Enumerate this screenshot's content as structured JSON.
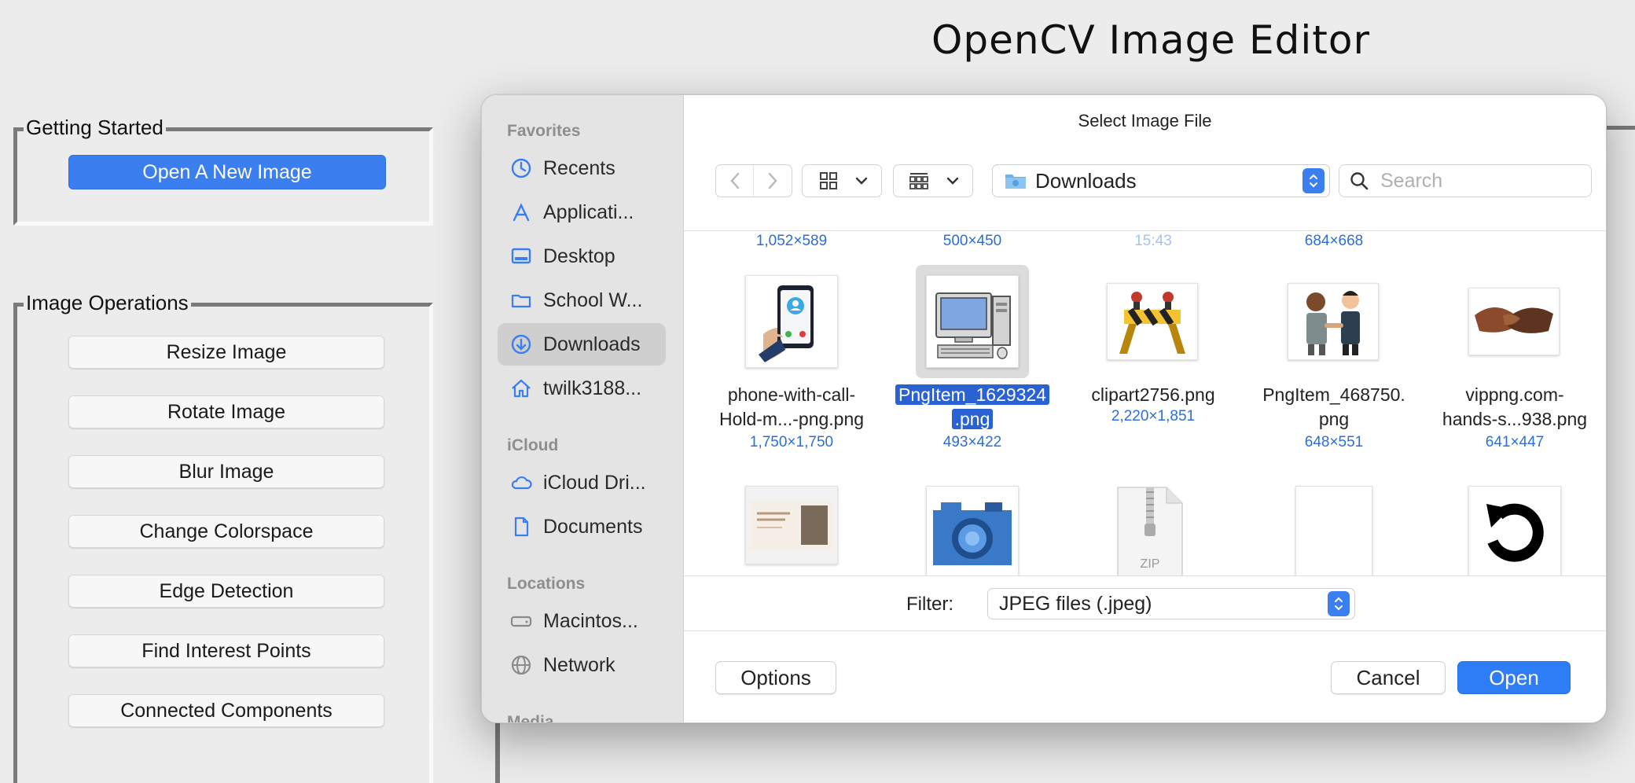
{
  "app": {
    "title": "OpenCV Image Editor"
  },
  "getting_started": {
    "legend": "Getting Started",
    "open_button": "Open A New Image"
  },
  "image_operations": {
    "legend": "Image Operations",
    "buttons": [
      "Resize Image",
      "Rotate Image",
      "Blur Image",
      "Change Colorspace",
      "Edge Detection",
      "Find Interest Points",
      "Connected Components"
    ]
  },
  "dialog": {
    "title": "Select Image File",
    "sidebar": {
      "favorites_header": "Favorites",
      "favorites": [
        {
          "label": "Recents",
          "icon": "clock-icon"
        },
        {
          "label": "Applicati...",
          "icon": "applications-icon"
        },
        {
          "label": "Desktop",
          "icon": "desktop-icon"
        },
        {
          "label": "School W...",
          "icon": "folder-icon"
        },
        {
          "label": "Downloads",
          "icon": "download-icon"
        },
        {
          "label": "twilk3188...",
          "icon": "home-icon"
        }
      ],
      "icloud_header": "iCloud",
      "icloud": [
        {
          "label": "iCloud Dri...",
          "icon": "cloud-icon"
        },
        {
          "label": "Documents",
          "icon": "document-icon"
        }
      ],
      "locations_header": "Locations",
      "locations": [
        {
          "label": "Macintos...",
          "icon": "drive-icon"
        },
        {
          "label": "Network",
          "icon": "globe-icon"
        }
      ],
      "media_header": "Media"
    },
    "location": "Downloads",
    "search_placeholder": "Search",
    "top_row_dims": [
      "1,052×589",
      "500×450",
      "15:43",
      "684×668"
    ],
    "files": [
      {
        "name_line1": "phone-with-call-",
        "name_line2": "Hold-m...-png.png",
        "dims": "1,750×1,750"
      },
      {
        "name_line1": "PngItem_1629324",
        "name_line2": ".png",
        "dims": "493×422",
        "selected": true
      },
      {
        "name_line1": "clipart2756.png",
        "name_line2": "",
        "dims": "2,220×1,851"
      },
      {
        "name_line1": "PngItem_468750.",
        "name_line2": "png",
        "dims": "648×551"
      },
      {
        "name_line1": "vippng.com-",
        "name_line2": "hands-s...938.png",
        "dims": "641×447"
      }
    ],
    "bottom_row_icons": [
      "presentation-thumb",
      "camera-thumb",
      "zip-icon",
      "blank-file-thumb",
      "rotate-icon"
    ],
    "zip_label": "ZIP",
    "filter_label": "Filter:",
    "filter_value": "JPEG files (.jpeg)",
    "options_button": "Options",
    "cancel_button": "Cancel",
    "open_button": "Open",
    "colors": {
      "accent": "#3b7ef0",
      "selection": "#2a62d4"
    }
  }
}
